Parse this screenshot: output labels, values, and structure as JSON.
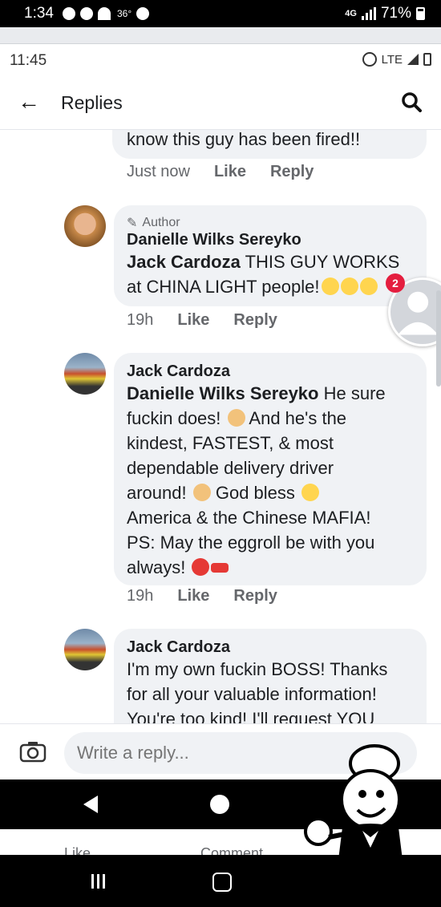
{
  "outer_status": {
    "time": "1:34",
    "temp": "36°",
    "network": "4G",
    "battery": "71%"
  },
  "inner_status": {
    "time": "11:45",
    "network": "LTE"
  },
  "header": {
    "back_icon": "arrow-left-icon",
    "title": "Replies",
    "search_icon": "search-icon"
  },
  "chat_head": {
    "badge": "2"
  },
  "comments": [
    {
      "text": "know this guy has been fired!!",
      "time": "Just now",
      "like": "Like",
      "reply": "Reply"
    },
    {
      "author_label": "Author",
      "name": "Danielle Wilks Sereyko",
      "mention": "Jack Cardoza",
      "text": " THIS GUY WORKS at CHINA LIGHT people!",
      "time": "19h",
      "like": "Like",
      "reply": "Reply"
    },
    {
      "name": "Jack Cardoza",
      "mention": "Danielle Wilks Sereyko",
      "text_lines": [
        " He sure",
        "fuckin does! ",
        " And he's the",
        "kindest, FASTEST, & most",
        "dependable delivery driver",
        "around! ",
        " God bless ",
        "America & the Chinese MAFIA!",
        "PS: May the eggroll be with you",
        "always! "
      ],
      "time": "19h",
      "like": "Like",
      "reply": "Reply"
    },
    {
      "name": "Jack Cardoza",
      "text_lines": [
        "I'm my own fuckin BOSS! Thanks",
        "for all your valuable information!",
        "You're too kind! I'll request YOU"
      ]
    }
  ],
  "composer": {
    "placeholder": "Write a reply..."
  },
  "actions": {
    "like": "Like",
    "comment": "Comment"
  }
}
